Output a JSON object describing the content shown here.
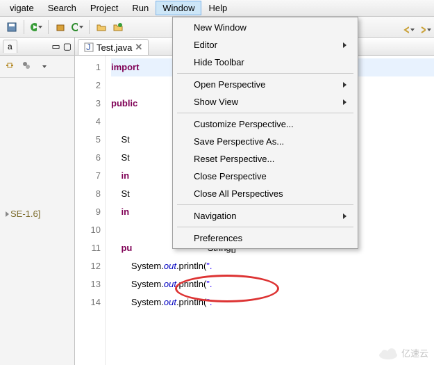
{
  "menubar": {
    "items": [
      "vigate",
      "Search",
      "Project",
      "Run",
      "Window",
      "Help"
    ],
    "active_index": 4
  },
  "dropdown": {
    "groups": [
      [
        "New Window",
        "Editor",
        "Hide Toolbar"
      ],
      [
        "Open Perspective",
        "Show View"
      ],
      [
        "Customize Perspective...",
        "Save Perspective As...",
        "Reset Perspective...",
        "Close Perspective",
        "Close All Perspectives"
      ],
      [
        "Navigation"
      ],
      [
        "Preferences"
      ]
    ],
    "submenu_items": [
      "Editor",
      "Open Perspective",
      "Show View",
      "Navigation"
    ],
    "highlighted": "Preferences"
  },
  "sidebar": {
    "tab_label": "a",
    "tree_label": "SE-1.6]"
  },
  "editor": {
    "tab": {
      "filename": "Test.java"
    },
    "lines": [
      {
        "n": 1,
        "pre": "",
        "kw": "import",
        "rest": ""
      },
      {
        "n": 2,
        "pre": "",
        "kw": "",
        "rest": ""
      },
      {
        "n": 3,
        "pre": "",
        "kw": "public",
        "rest": ""
      },
      {
        "n": 4,
        "pre": "",
        "kw": "",
        "rest": ""
      },
      {
        "n": 5,
        "pre": "    St",
        "kw": "",
        "rest": ""
      },
      {
        "n": 6,
        "pre": "    St",
        "kw": "",
        "rest": ""
      },
      {
        "n": 7,
        "pre": "    ",
        "kw": "in",
        "rest": ""
      },
      {
        "n": 8,
        "pre": "    St",
        "kw": "",
        "rest": ""
      },
      {
        "n": 9,
        "pre": "    ",
        "kw": "in",
        "rest": ""
      },
      {
        "n": 10,
        "pre": "",
        "kw": "",
        "rest": ""
      },
      {
        "n": 11,
        "pre": "    ",
        "kw": "pu",
        "rest": "",
        "tail_plain": "String[]"
      },
      {
        "n": 12,
        "pre": "        System.",
        "fld": "out",
        "call": ".println(",
        "str": "\".",
        "tail": ""
      },
      {
        "n": 13,
        "pre": "        System.",
        "fld": "out",
        "call": ".println(",
        "str": "\".",
        "tail": ""
      },
      {
        "n": 14,
        "pre": "        System.",
        "fld": "out",
        "call": ".println(",
        "str": "\".",
        "tail": ""
      }
    ]
  },
  "watermark": "亿速云"
}
